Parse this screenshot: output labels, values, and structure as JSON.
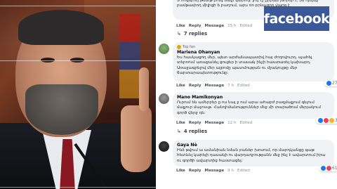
{
  "logo": {
    "text": "facebook",
    "color": "#3b5998"
  },
  "comments": [
    {
      "name": "",
      "text": "Տ հոգեբույ թեսւթ բուգ նալի կարողէ լույ էչ ըրբան խորեր է, իօ ոյելաչ բամթափող միլիցի ե բաղում, արս ռո բրնացող վարք է",
      "actions": {
        "like": "Like",
        "reply": "Reply",
        "message": "Message",
        "time": "15 h",
        "edited": "Edited"
      },
      "replies": "7 replies",
      "reaction_count": ""
    },
    {
      "name": "Mariena Ohanyan",
      "badge": "Top fan",
      "text": "Ես հասկացող մեր, պետ արժանապատիվ հայ ժողովուրդ, պահել տերոում առաջանել ցուցեր ի տասակ ինչի հաստառել կախարդ. Առաջագրելով մեր ալբոմը պատմության ու մշակույթը մեր ճարտարապետությունը:",
      "actions": {
        "like": "Like",
        "reply": "Reply",
        "message": "Message",
        "time": "7 h",
        "edited": "Edited"
      },
      "replies": "",
      "reaction_count": "27"
    },
    {
      "name": "Mano Mamikonyan",
      "text": "Ուրում են ամերբեր ը ոս նալ ջ ում արա ահաբժ բազմաքում գելում մաքուր մաչոսւթ. Հանդիմանություններ մեջ մի տարածում մերյակում գործ վերջ դե:",
      "actions": {
        "like": "Like",
        "reply": "Reply",
        "message": "Message",
        "time": "12 h",
        "edited": "Edited"
      },
      "replies": "4 replies",
      "reaction_count": "319"
    },
    {
      "name": "Gaya Nè",
      "text": "Ինձ թվում ա ամանիան նման բաներ խոսում, որ մարդկանցը գաթ հետևել կարելի դասակի ու վարդադրությանն մեջ ինչ է ավարտում իրա ու գործի ավարտից հաստացել:",
      "actions": {
        "like": "Like",
        "reply": "Reply",
        "message": "Message",
        "time": "9 h",
        "edited": "Edited"
      },
      "replies": "",
      "reaction_count": "61"
    }
  ]
}
